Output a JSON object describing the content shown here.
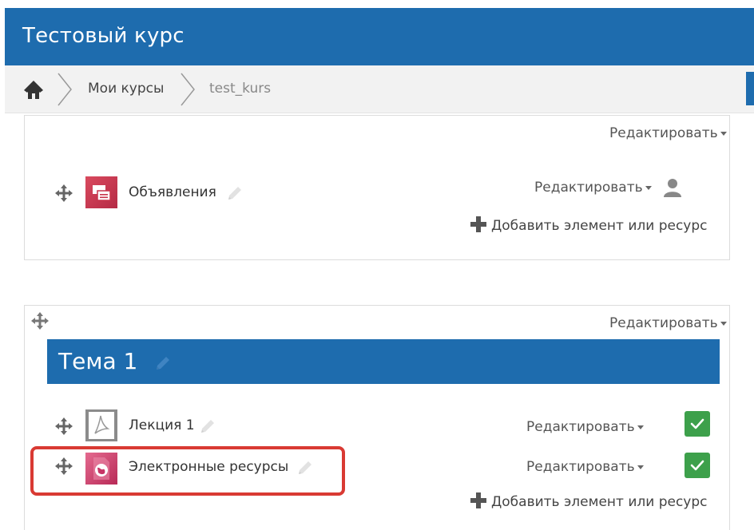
{
  "header": {
    "title": "Тестовый курс"
  },
  "breadcrumb": {
    "items": [
      {
        "label": "Мои курсы"
      },
      {
        "label": "test_kurs"
      }
    ]
  },
  "sections": [
    {
      "edit_label": "Редактировать",
      "activities": [
        {
          "name": "Объявления",
          "edit_label": "Редактировать",
          "icon": "forum-icon",
          "icon_color": "#c7344b"
        }
      ],
      "add_label": "Добавить элемент или ресурс"
    },
    {
      "edit_label": "Редактировать",
      "title": "Тема 1",
      "activities": [
        {
          "name": "Лекция 1",
          "edit_label": "Редактировать",
          "icon": "pdf-file-icon",
          "completed": true
        },
        {
          "name": "Электронные ресурсы",
          "edit_label": "Редактировать",
          "icon": "url-resource-icon",
          "icon_color": "#c73566",
          "completed": true
        }
      ],
      "add_label": "Добавить элемент или ресурс"
    }
  ],
  "colors": {
    "brand": "#1e6cae",
    "check": "#3da04b",
    "highlight": "#d93a33"
  }
}
